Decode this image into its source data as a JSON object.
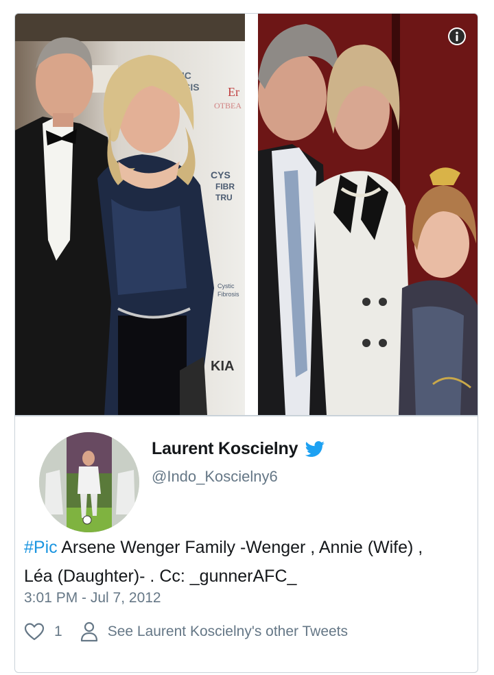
{
  "tweet": {
    "author_name": "Laurent Koscielny",
    "author_handle": "@Indo_Koscielny6",
    "hashtag": "#Pic",
    "text": " Arsene Wenger Family -Wenger , Annie (Wife) , Léa (Daughter)- . Cc: _gunnerAFC_",
    "timestamp": "3:01 PM - Jul 7, 2012",
    "like_count": "1",
    "see_other_label": "See Laurent Koscielny's other Tweets"
  },
  "icons": {
    "info": "info-icon",
    "verified_badge": "twitter-bird-icon",
    "like": "heart-icon",
    "profile": "person-icon"
  },
  "colors": {
    "link_blue": "#1b95e0",
    "secondary_text": "#657786",
    "border": "#c9d2d9"
  }
}
